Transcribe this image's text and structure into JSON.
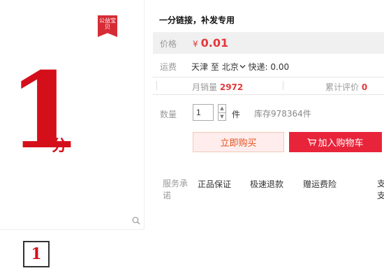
{
  "product": {
    "badge_text": "公益宝贝",
    "hero_big": "1",
    "hero_small": "分",
    "thumb_text": "1",
    "title": "一分链接，补发专用"
  },
  "price": {
    "label": "价格",
    "currency": "¥",
    "value": "0.01"
  },
  "shipping": {
    "label": "运费",
    "from": "天津",
    "to_word": "至",
    "to": "北京",
    "method": "快递: 0.00"
  },
  "stats": {
    "monthly_label": "月销量",
    "monthly_value": "2972",
    "reviews_label": "累计评价",
    "reviews_value": "0"
  },
  "quantity": {
    "label": "数量",
    "value": "1",
    "up": "▲",
    "down": "▼",
    "unit": "件",
    "stock": "库存978364件"
  },
  "buttons": {
    "buy_now": "立即购买",
    "add_to_cart": "加入购物车"
  },
  "services": {
    "label": "服务承诺",
    "items": [
      "正品保证",
      "极速退款",
      "赠运费险"
    ],
    "cutoff": "支支"
  },
  "colors": {
    "accent": "#e4393c",
    "cart": "#e8243a",
    "buy_bg": "#ffeded"
  },
  "icons": {
    "cart": "cart-icon",
    "zoom": "search-icon",
    "dropdown": "chevron-down-icon"
  }
}
